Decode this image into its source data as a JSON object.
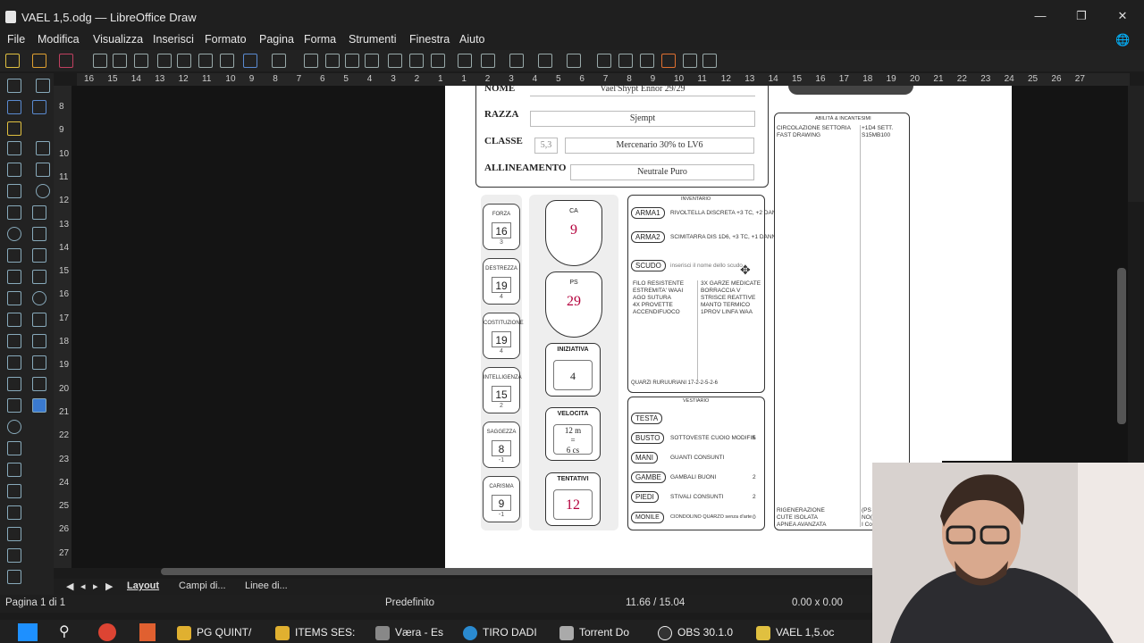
{
  "window": {
    "title": "VAEL 1,5.odg — LibreOffice Draw",
    "controls": [
      "—",
      "❐",
      "✕"
    ]
  },
  "menu": [
    "File",
    "Modifica",
    "Visualizza",
    "Inserisci",
    "Formato",
    "Pagina",
    "Forma",
    "Strumenti",
    "Finestra",
    "Aiuto"
  ],
  "ruler": {
    "h_ticks": [
      "16",
      "15",
      "14",
      "13",
      "12",
      "11",
      "10",
      "9",
      "8",
      "7",
      "6",
      "5",
      "4",
      "3",
      "2",
      "1",
      "1",
      "2",
      "3",
      "4",
      "5",
      "6",
      "7",
      "8",
      "9",
      "10",
      "11",
      "12",
      "13",
      "14",
      "15",
      "16",
      "17",
      "18",
      "19",
      "20",
      "21",
      "22",
      "23",
      "24",
      "25",
      "26",
      "27"
    ],
    "v_ticks": [
      "8",
      "9",
      "10",
      "11",
      "12",
      "13",
      "14",
      "15",
      "16",
      "17",
      "18",
      "19",
      "20",
      "21",
      "22",
      "23",
      "24",
      "25",
      "26",
      "27"
    ]
  },
  "sheet": {
    "nome_label": "NOME",
    "nome_value": "Vael'Shypt Ennor 29/29",
    "razza_label": "RAZZA",
    "razza_value": "Sjempt",
    "classe_label": "CLASSE",
    "classe_level": "5,3",
    "classe_value": "Mercenario 30% to LV6",
    "allineamento_label": "ALLINEAMENTO",
    "allineamento_value": "Neutrale Puro",
    "stats": [
      {
        "name": "FORZA",
        "value": "16",
        "mod": "3"
      },
      {
        "name": "DESTREZZA",
        "value": "19",
        "mod": "4"
      },
      {
        "name": "COSTITUZIONE",
        "value": "19",
        "mod": "4"
      },
      {
        "name": "INTELLIGENZA",
        "value": "15",
        "mod": "2"
      },
      {
        "name": "SAGGEZZA",
        "value": "8",
        "mod": "-1"
      },
      {
        "name": "CARISMA",
        "value": "9",
        "mod": "-1"
      }
    ],
    "ca_label": "CA",
    "ca_value": "9",
    "ps_label": "PS",
    "ps_value": "29",
    "iniziativa_label": "INIZIATIVA",
    "iniziativa_value": "4",
    "velocita_label": "VELOCITA",
    "velocita_value1": "12 m",
    "velocita_eq": "=",
    "velocita_value2": "6 cs",
    "tentativi_label": "TENTATIVI",
    "tentativi_value": "12",
    "inventario_title": "INVENTARIO",
    "arma1_label": "ARMA1",
    "arma1_value": "RIVOLTELLA DISCRETA +3 TC, +2 DANNI",
    "arma2_label": "ARMA2",
    "arma2_value": "SCIMITARRA DIS 1D6, +3 TC, +1 DANNI",
    "scudo_label": "SCUDO",
    "scudo_value": "inserisci il nome dello scudo",
    "inv_left": [
      "FILO RESISTENTE",
      "ESTREMITA' WAAI",
      "AGO SUTURA",
      "4X PROVETTE",
      "ACCENDIFUOCO"
    ],
    "inv_right": [
      "3X GARZE MEDICATE",
      "BORRACCIA V",
      "STRISCE REATTIVE",
      "MANTO TERMICO",
      "1PROV LINFA WAA"
    ],
    "quarzi": "QUARZI RURUURIANI 17-2-2-5-2-6",
    "vestiario_title": "VESTIARIO",
    "vestiario": [
      {
        "slot": "TESTA",
        "item": "",
        "val": ""
      },
      {
        "slot": "BUSTO",
        "item": "SOTTOVESTE CUOIO MODIFIK",
        "val": "5"
      },
      {
        "slot": "MANI",
        "item": "GUANTI CONSUNTI",
        "val": ""
      },
      {
        "slot": "GAMBE",
        "item": "GAMBALI BUONI",
        "val": "2"
      },
      {
        "slot": "PIEDI",
        "item": "STIVALI CONSUNTI",
        "val": "2"
      },
      {
        "slot": "MONILE",
        "item": "CIONDOLINO QUARZO senza d'arte",
        "val": "0"
      }
    ],
    "abilita_title": "ABILITÀ & INCANTESIMI",
    "abilita_top": [
      "CIRCOLAZIONE SETTORIA",
      "FAST DRAWING"
    ],
    "abilita_top_right": [
      "+1D4 SETT.",
      "S15MB100"
    ],
    "abilita_bottom": [
      "RIGENERAZIONE",
      "CUTE ISOLATA",
      "APNEA AVANZATA"
    ],
    "abilita_bottom_right": [
      "(PS",
      "NO(",
      "I Co"
    ]
  },
  "tabs": [
    "Layout",
    "Campi di...",
    "Linee di..."
  ],
  "status": {
    "page": "Pagina 1 di 1",
    "style": "Predefinito",
    "position": "11.66 / 15.04",
    "size": "0.00 x 0.00"
  },
  "taskbar": [
    "PG QUINT/",
    "ITEMS SES:",
    "Væra - Es",
    "TIRO DADI",
    "Torrent Do",
    "OBS 30.1.0",
    "VAEL 1,5.oc"
  ]
}
